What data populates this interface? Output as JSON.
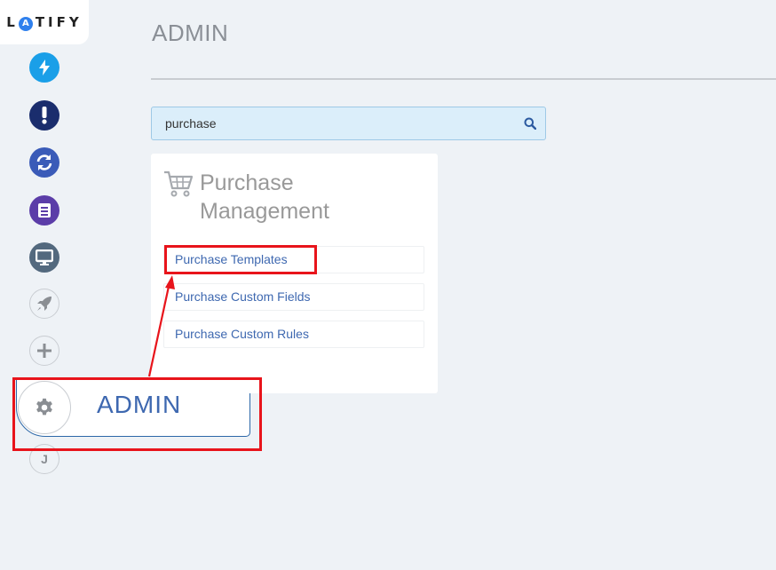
{
  "brand": {
    "logo_text": "LATIFY",
    "logo_letter_a": "A"
  },
  "sidebar": {
    "items": [
      {
        "name": "lightning",
        "color": "#1a9fe8"
      },
      {
        "name": "alert",
        "color": "#1a2d6d"
      },
      {
        "name": "refresh",
        "color": "#3a5bb8"
      },
      {
        "name": "book",
        "color": "#5b3da8"
      },
      {
        "name": "monitor",
        "color": "#53697e"
      },
      {
        "name": "rocket",
        "color": "#8a8e93"
      },
      {
        "name": "plus",
        "color": "#8a8e93"
      },
      {
        "name": "admin-gear",
        "color": "#8a8e93"
      },
      {
        "name": "user-initial",
        "color": "#8a8e93",
        "label": "J"
      }
    ],
    "admin_label": "ADMIN"
  },
  "header": {
    "title": "ADMIN"
  },
  "search": {
    "value": "purchase"
  },
  "card": {
    "title_line1": "Purchase",
    "title_line2": "Management",
    "links": [
      "Purchase Templates",
      "Purchase Custom Fields",
      "Purchase Custom Rules"
    ]
  },
  "colors": {
    "accent": "#3e68b0",
    "annotation": "#e8141b",
    "background": "#eef2f6"
  }
}
